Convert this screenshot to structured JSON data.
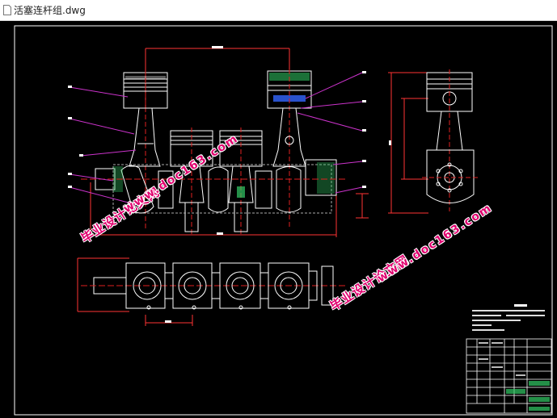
{
  "window": {
    "title": "活塞连杆组.dwg",
    "icon": "dwg-file-icon"
  },
  "watermark": {
    "chinese_text": "毕业设计论文网",
    "url_text": "www.doc163.com",
    "color": "#e0006e"
  },
  "colors": {
    "canvas_background": "#000000",
    "line_white": "#ffffff",
    "leader_magenta": "#cc33cc",
    "center_red": "#e02020",
    "hatch_green": "#33cc66",
    "dimension_red": "#ff3333"
  },
  "drawing": {
    "views": [
      "front-section-view",
      "side-view",
      "top-view",
      "title-block"
    ]
  }
}
